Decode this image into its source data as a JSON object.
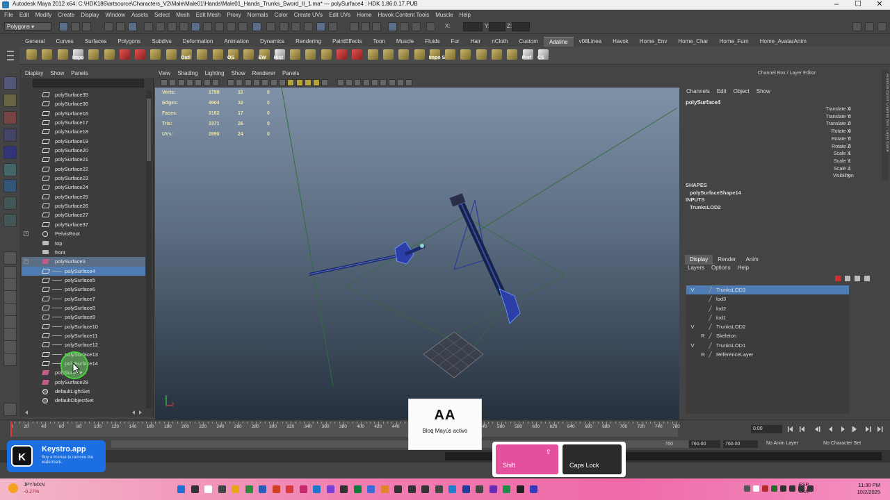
{
  "window": {
    "title": "Autodesk Maya 2012 x64: C:\\HDK186\\artsource\\Characters_V2\\Male\\Male01\\Hands\\Male01_Hands_Trunks_Sword_II_1.ma*   ---   polySurface4 : HDK 1.86.0.17.PUB",
    "minimize": "–",
    "maximize": "☐",
    "close": "✕"
  },
  "menubar": [
    "File",
    "Edit",
    "Modify",
    "Create",
    "Display",
    "Window",
    "Assets",
    "Select",
    "Mesh",
    "Edit Mesh",
    "Proxy",
    "Normals",
    "Color",
    "Create UVs",
    "Edit UVs",
    "Home",
    "Havok Content Tools",
    "Muscle",
    "Help"
  ],
  "status": {
    "mode": "Polygons",
    "x_label": "X:",
    "y_label": "Y:",
    "z_label": "Z:"
  },
  "shelf_tabs": [
    "General",
    "Curves",
    "Surfaces",
    "Polygons",
    "Subdivs",
    "Deformation",
    "Animation",
    "Dynamics",
    "Rendering",
    "PaintEffects",
    "Toon",
    "Muscle",
    "Fluids",
    "Fur",
    "Hair",
    "nCloth",
    "Custom",
    "Adaline",
    "v08Linea",
    "Havok",
    "Home_Env",
    "Home_Char",
    "Home_Furn",
    "Home_AvatarAnim"
  ],
  "active_shelf": "Adaline",
  "shelf_labels": [
    "Impo",
    "Outl",
    "OS",
    "EW",
    "Hist",
    "Impo SSA",
    "Pref",
    "CS"
  ],
  "outliner": {
    "menu": [
      "Display",
      "Show",
      "Panels"
    ],
    "items": [
      {
        "label": "polySurface35",
        "icon": "mesh",
        "indent": 0
      },
      {
        "label": "polySurface36",
        "icon": "mesh",
        "indent": 0
      },
      {
        "label": "polySurface16",
        "icon": "mesh",
        "indent": 0
      },
      {
        "label": "polySurface17",
        "icon": "mesh",
        "indent": 0
      },
      {
        "label": "polySurface18",
        "icon": "mesh",
        "indent": 0
      },
      {
        "label": "polySurface19",
        "icon": "mesh",
        "indent": 0
      },
      {
        "label": "polySurface20",
        "icon": "mesh",
        "indent": 0
      },
      {
        "label": "polySurface21",
        "icon": "mesh",
        "indent": 0
      },
      {
        "label": "polySurface22",
        "icon": "mesh",
        "indent": 0
      },
      {
        "label": "polySurface23",
        "icon": "mesh",
        "indent": 0
      },
      {
        "label": "polySurface24",
        "icon": "mesh",
        "indent": 0
      },
      {
        "label": "polySurface25",
        "icon": "mesh",
        "indent": 0
      },
      {
        "label": "polySurface26",
        "icon": "mesh",
        "indent": 0
      },
      {
        "label": "polySurface27",
        "icon": "mesh",
        "indent": 0
      },
      {
        "label": "polySurface37",
        "icon": "mesh",
        "indent": 0
      },
      {
        "label": "PelvisRoot",
        "icon": "joint",
        "indent": 0,
        "expander": "+"
      },
      {
        "label": "top",
        "icon": "cam",
        "indent": 0
      },
      {
        "label": "front",
        "icon": "cam",
        "indent": 0
      },
      {
        "label": "polySurface3",
        "icon": "grp",
        "indent": 0,
        "expander": "−",
        "state": "hl"
      },
      {
        "label": "polySurface4",
        "icon": "mesh",
        "indent": 1,
        "state": "sel"
      },
      {
        "label": "polySurface5",
        "icon": "mesh",
        "indent": 1
      },
      {
        "label": "polySurface6",
        "icon": "mesh",
        "indent": 1
      },
      {
        "label": "polySurface7",
        "icon": "mesh",
        "indent": 1
      },
      {
        "label": "polySurface8",
        "icon": "mesh",
        "indent": 1
      },
      {
        "label": "polySurface9",
        "icon": "mesh",
        "indent": 1
      },
      {
        "label": "polySurface10",
        "icon": "mesh",
        "indent": 1
      },
      {
        "label": "polySurface11",
        "icon": "mesh",
        "indent": 1
      },
      {
        "label": "polySurface12",
        "icon": "mesh",
        "indent": 1
      },
      {
        "label": "polySurface13",
        "icon": "mesh",
        "indent": 1
      },
      {
        "label": "polySurface14",
        "icon": "mesh",
        "indent": 1
      },
      {
        "label": "polySurface...",
        "icon": "grp",
        "indent": 0
      },
      {
        "label": "polySurface28",
        "icon": "grp",
        "indent": 0
      },
      {
        "label": "defaultLightSet",
        "icon": "set",
        "indent": 0
      },
      {
        "label": "defaultObjectSet",
        "icon": "set",
        "indent": 0
      }
    ]
  },
  "viewport": {
    "menu": [
      "View",
      "Shading",
      "Lighting",
      "Show",
      "Renderer",
      "Panels"
    ],
    "hud": [
      {
        "label": "Verts:",
        "v1": "1799",
        "v2": "16",
        "v3": "0"
      },
      {
        "label": "Edges:",
        "v1": "4904",
        "v2": "32",
        "v3": "0"
      },
      {
        "label": "Faces:",
        "v1": "3162",
        "v2": "17",
        "v3": "0"
      },
      {
        "label": "Tris:",
        "v1": "3371",
        "v2": "26",
        "v3": "0"
      },
      {
        "label": "UVs:",
        "v1": "2890",
        "v2": "24",
        "v3": "0"
      }
    ],
    "axis_y": "y",
    "axis_x": "x"
  },
  "channel_box": {
    "title": "Channel Box / Layer Editor",
    "menu": [
      "Channels",
      "Edit",
      "Object",
      "Show"
    ],
    "node": "polySurface4",
    "attributes": [
      {
        "name": "Translate X",
        "value": "0"
      },
      {
        "name": "Translate Y",
        "value": "0"
      },
      {
        "name": "Translate Z",
        "value": "0"
      },
      {
        "name": "Rotate X",
        "value": "0"
      },
      {
        "name": "Rotate Y",
        "value": "0"
      },
      {
        "name": "Rotate Z",
        "value": "0"
      },
      {
        "name": "Scale X",
        "value": "1"
      },
      {
        "name": "Scale Y",
        "value": "1"
      },
      {
        "name": "Scale Z",
        "value": "1"
      },
      {
        "name": "Visibility",
        "value": "on"
      }
    ],
    "shapes_header": "SHAPES",
    "shape": "polySurfaceShape14",
    "inputs_header": "INPUTS",
    "input": "TrunksLOD2"
  },
  "layer_editor": {
    "tabs": [
      "Display",
      "Render",
      "Anim"
    ],
    "menu": [
      "Layers",
      "Options",
      "Help"
    ],
    "layers": [
      {
        "vis": "V",
        "ref": "",
        "name": "TrunksLOD3",
        "state": "sel"
      },
      {
        "vis": "",
        "ref": "",
        "name": "lod3"
      },
      {
        "vis": "",
        "ref": "",
        "name": "lod2"
      },
      {
        "vis": "",
        "ref": "",
        "name": "lod1"
      },
      {
        "vis": "V",
        "ref": "",
        "name": "TrunksLOD2"
      },
      {
        "vis": "",
        "ref": "R",
        "name": "Skeleton"
      },
      {
        "vis": "V",
        "ref": "",
        "name": "TrunksLOD1"
      },
      {
        "vis": "",
        "ref": "R",
        "name": "ReferenceLayer"
      }
    ]
  },
  "time_slider": {
    "ticks": [
      "0",
      "20",
      "40",
      "60",
      "80",
      "100",
      "120",
      "140",
      "160",
      "180",
      "200",
      "220",
      "240",
      "260",
      "280",
      "300",
      "320",
      "340",
      "360",
      "380",
      "400",
      "420",
      "440",
      "460",
      "480",
      "500",
      "520",
      "540",
      "560",
      "580",
      "600",
      "620",
      "640",
      "660",
      "680",
      "700",
      "720",
      "740",
      "760"
    ],
    "current": "0.00"
  },
  "range_slider": {
    "end_display": "760",
    "end": "760.00",
    "end2": "760.00",
    "anim_layer": "No Anim Layer",
    "char_set": "No Character Set"
  },
  "keystro": {
    "letter": "K",
    "name": "Keystro.app",
    "note": "Buy a license to remove the watermark."
  },
  "caps_popup": {
    "icon": "AA",
    "text": "Bloq Mayús activo"
  },
  "keys": [
    {
      "label": "Shift",
      "arrow": "⇧"
    },
    {
      "label": "Caps Lock"
    }
  ],
  "taskbar": {
    "weather_1": "JPY/MXN",
    "weather_2": "-0.27%",
    "lang_1": "ESP",
    "lang_2": "LAA",
    "time": "11:30 PM",
    "date": "10/2/2025"
  }
}
